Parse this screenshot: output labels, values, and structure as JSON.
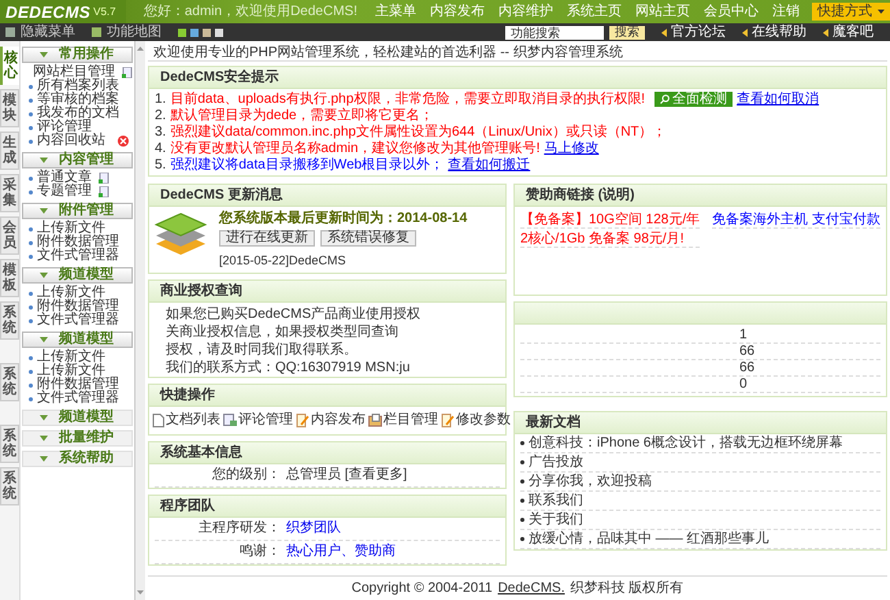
{
  "header": {
    "logo": "DEDECMS",
    "version": "V5.7",
    "greeting": "您好：admin，欢迎使用DedeCMS!",
    "nav": [
      "主菜单",
      "内容发布",
      "内容维护",
      "系统主页",
      "网站主页",
      "会员中心",
      "注销"
    ],
    "shortcut": "快捷方式"
  },
  "toolbar": {
    "hide_menu": "隐藏菜单",
    "site_map": "功能地图",
    "search": {
      "value": "功能搜索",
      "button": "搜索"
    },
    "links": [
      "官方论坛",
      "在线帮助",
      "魔客吧"
    ]
  },
  "side_tabs": [
    {
      "label": "核心",
      "selected": true
    },
    {
      "label": "模块",
      "selected": false
    },
    {
      "label": "生成",
      "selected": false
    },
    {
      "label": "采集",
      "selected": false
    },
    {
      "label": "会员",
      "selected": false
    },
    {
      "label": "模板",
      "selected": false
    },
    {
      "label": "系统",
      "selected": false
    },
    {
      "label": "系统",
      "selected": false
    },
    {
      "label": "系统",
      "selected": false
    },
    {
      "label": "系统",
      "selected": false
    }
  ],
  "menu": [
    {
      "title": "常用操作",
      "expanded": true,
      "items": [
        {
          "label": "网站栏目管理",
          "kind": "add"
        },
        {
          "label": "所有档案列表",
          "kind": "plain"
        },
        {
          "label": "等审核的档案",
          "kind": "plain"
        },
        {
          "label": "我发布的文档",
          "kind": "plain"
        },
        {
          "label": "评论管理",
          "kind": "plain"
        },
        {
          "label": "内容回收站",
          "kind": "remove"
        }
      ]
    },
    {
      "title": "内容管理",
      "expanded": true,
      "items": [
        {
          "label": "普通文章",
          "kind": "add"
        },
        {
          "label": "专题管理",
          "kind": "add"
        }
      ]
    },
    {
      "title": "附件管理",
      "expanded": true,
      "items": [
        {
          "label": "上传新文件",
          "kind": "plain"
        },
        {
          "label": "附件数据管理",
          "kind": "plain"
        },
        {
          "label": "文件式管理器",
          "kind": "plain"
        }
      ]
    },
    {
      "title": "频道模型",
      "expanded": true,
      "items": [
        {
          "label": "上传新文件",
          "kind": "plain"
        },
        {
          "label": "附件数据管理",
          "kind": "plain"
        },
        {
          "label": "文件式管理器",
          "kind": "plain"
        }
      ]
    },
    {
      "title": "频道模型",
      "expanded": true,
      "items": [
        {
          "label": "上传新文件",
          "kind": "plain"
        },
        {
          "label": "上传新文件",
          "kind": "plain"
        },
        {
          "label": "附件数据管理",
          "kind": "plain"
        },
        {
          "label": "文件式管理器",
          "kind": "plain"
        }
      ]
    },
    {
      "title": "频道模型",
      "expanded": false
    },
    {
      "title": "批量维护",
      "expanded": false
    },
    {
      "title": "系统帮助",
      "expanded": false
    }
  ],
  "welcome": "欢迎使用专业的PHP网站管理系统，轻松建站的首选利器 -- 织梦内容管理系统",
  "security": {
    "title": "DedeCMS安全提示",
    "items": [
      {
        "number": "1.",
        "text": "目前data、uploads有执行.php权限，非常危险，需要立即取消目录的执行权限!",
        "color": "#ff0000"
      },
      {
        "number": "2.",
        "text": "默认管理目录为dede，需要立即将它更名；",
        "color": "#ff0000"
      },
      {
        "number": "3.",
        "text": "强烈建议data/common.inc.php文件属性设置为644（Linux/Unix）或只读（NT）；",
        "color": "#ff0000"
      },
      {
        "number": "4.",
        "text": "没有更改默认管理员名称admin，建议您修改为其他管理账号!",
        "color": "#ff0000",
        "link": "马上修改"
      },
      {
        "number": "5.",
        "text": "强烈建议将data目录搬移到Web根目录以外；",
        "color": "#0000ff",
        "link": "查看如何搬迁"
      }
    ],
    "check_button": "全面检测",
    "check_link": "查看如何取消"
  },
  "update": {
    "title": "DedeCMS 更新消息",
    "headline": "您系统版本最后更新时间为：2014-08-14",
    "buttons": [
      "进行在线更新",
      "系统错误修复"
    ],
    "news": "[2015-05-22]DedeCMS"
  },
  "commerce": {
    "title": "商业授权查询",
    "lines": [
      "如果您已购买DedeCMS产品商业使用授权",
      "关商业授权信息，如果授权类型同查询",
      "授权，请及时同我们取得联系。",
      "我们的联系方式：QQ:16307919 MSN:ju"
    ]
  },
  "sponsor": {
    "title": "赞助商链接 **(说明)**",
    "links": [
      {
        "text": "【免备案】10G空间 128元/年",
        "color": "#ff0000"
      },
      {
        "text": "免备案海外主机 支付宝付款",
        "color": "#0000ff"
      },
      {
        "text": "2核心/1Gb 免备案 98元/月!",
        "color": "#ff0000"
      }
    ]
  },
  "stats": {
    "values": [
      "1",
      "66",
      "66",
      "0"
    ]
  },
  "quick": {
    "title": "快捷操作",
    "items": [
      {
        "label": "文档列表",
        "kind": "doc"
      },
      {
        "label": "评论管理",
        "kind": "comment"
      },
      {
        "label": "内容发布",
        "kind": "edit"
      },
      {
        "label": "栏目管理",
        "kind": "folder"
      },
      {
        "label": "修改参数",
        "kind": "edit"
      }
    ]
  },
  "sysinfo": {
    "title": "系统基本信息",
    "rows": [
      {
        "label": "您的级别：",
        "value": "总管理员 [查看更多]"
      }
    ]
  },
  "team": {
    "title": "程序团队",
    "rows": [
      {
        "label": "主程序研发：",
        "value": "织梦团队"
      },
      {
        "label": "鸣谢：",
        "value": "热心用户、赞助商"
      }
    ]
  },
  "latest": {
    "title": "最新文档",
    "items": [
      "创意科技：iPhone 6概念设计，搭载无边框环绕屏幕",
      "广告投放",
      "分享你我，欢迎投稿",
      "联系我们",
      "关于我们",
      "放缓心情，品味其中 —— 红酒那些事儿"
    ]
  },
  "footer": {
    "prefix": "Copyright © 2004-2011",
    "link": "DedeCMS.",
    "suffix": "织梦科技 版权所有"
  }
}
